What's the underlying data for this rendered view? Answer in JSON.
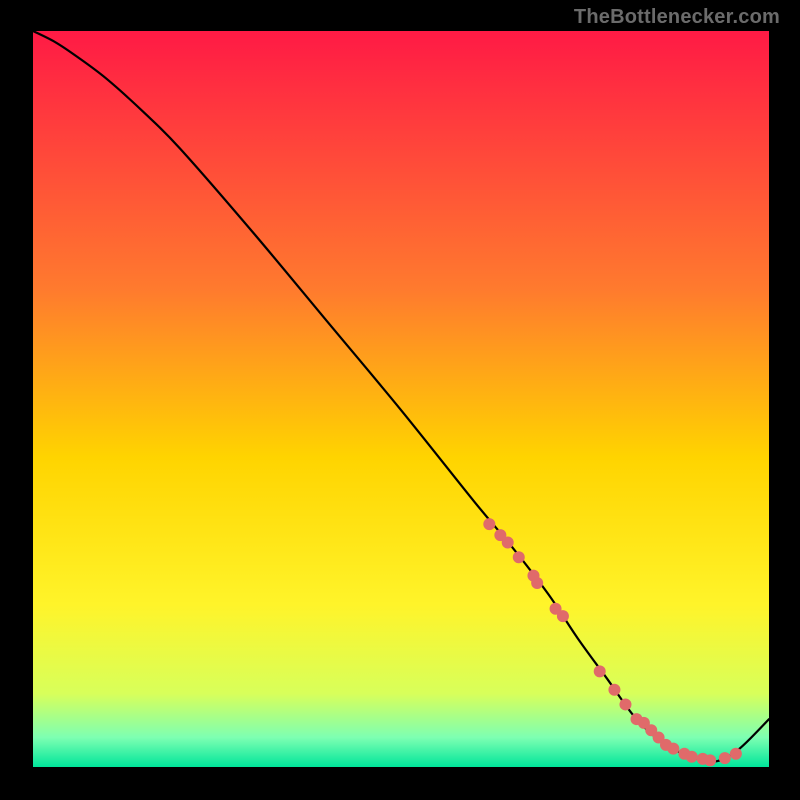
{
  "attribution": "TheBottlenecker.com",
  "colors": {
    "gradient_top": "#ff1a45",
    "gradient_mid1": "#ff7a2e",
    "gradient_mid2": "#ffd400",
    "gradient_mid3": "#fff42a",
    "gradient_low1": "#d8ff5a",
    "gradient_low2": "#7dffb2",
    "gradient_bottom": "#00e59a",
    "curve": "#000000",
    "marker": "#e06a6a"
  },
  "chart_data": {
    "type": "line",
    "title": "",
    "xlabel": "",
    "ylabel": "",
    "xlim": [
      0,
      100
    ],
    "ylim": [
      0,
      100
    ],
    "curve": {
      "x": [
        0,
        3,
        6,
        10,
        15,
        20,
        30,
        40,
        50,
        60,
        65,
        70,
        74,
        78,
        82,
        86,
        90,
        93,
        96,
        100
      ],
      "y": [
        100,
        98.5,
        96.5,
        93.5,
        89,
        84,
        72.5,
        60.5,
        48.5,
        36,
        30,
        23.5,
        17.5,
        12,
        6.5,
        3,
        1.2,
        0.8,
        2.5,
        6.5
      ]
    },
    "markers": {
      "x": [
        62,
        63.5,
        64.5,
        66,
        68,
        68.5,
        71,
        72,
        77,
        79,
        80.5,
        82,
        83,
        84,
        85,
        86,
        87,
        88.5,
        89.5,
        91,
        92,
        94,
        95.5
      ],
      "y": [
        33,
        31.5,
        30.5,
        28.5,
        26,
        25,
        21.5,
        20.5,
        13,
        10.5,
        8.5,
        6.5,
        6,
        5,
        4,
        3,
        2.5,
        1.8,
        1.4,
        1.1,
        0.9,
        1.2,
        1.8
      ]
    }
  }
}
